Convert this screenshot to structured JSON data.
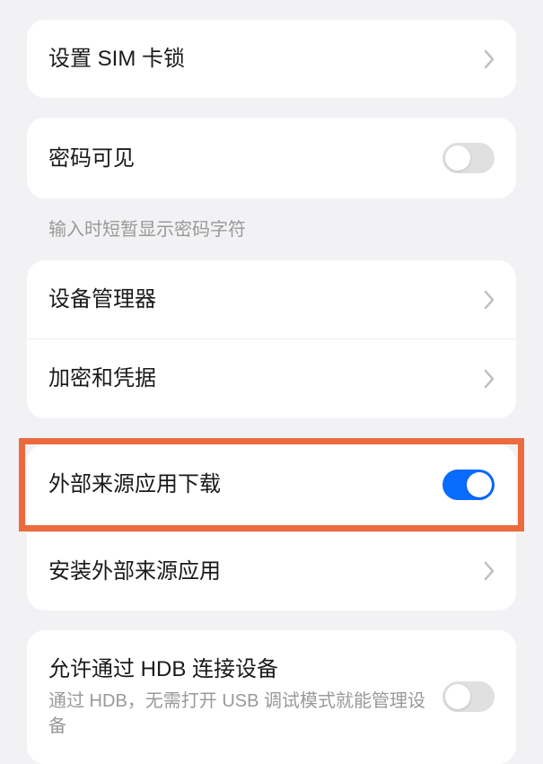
{
  "sections": {
    "sim": {
      "label": "设置 SIM 卡锁"
    },
    "passwordVisible": {
      "label": "密码可见",
      "helper": "输入时短暂显示密码字符",
      "toggle": false
    },
    "deviceAdmin": {
      "label": "设备管理器"
    },
    "encryption": {
      "label": "加密和凭据"
    },
    "externalDownload": {
      "label": "外部来源应用下载",
      "toggle": true,
      "highlighted": true
    },
    "installExternal": {
      "label": "安装外部来源应用"
    },
    "hdb": {
      "label": "允许通过 HDB 连接设备",
      "subtitle": "通过 HDB，无需打开 USB 调试模式就能管理设备",
      "toggle": false
    }
  },
  "highlight_color": "#ed6a3e",
  "accent_color": "#0a6cff"
}
